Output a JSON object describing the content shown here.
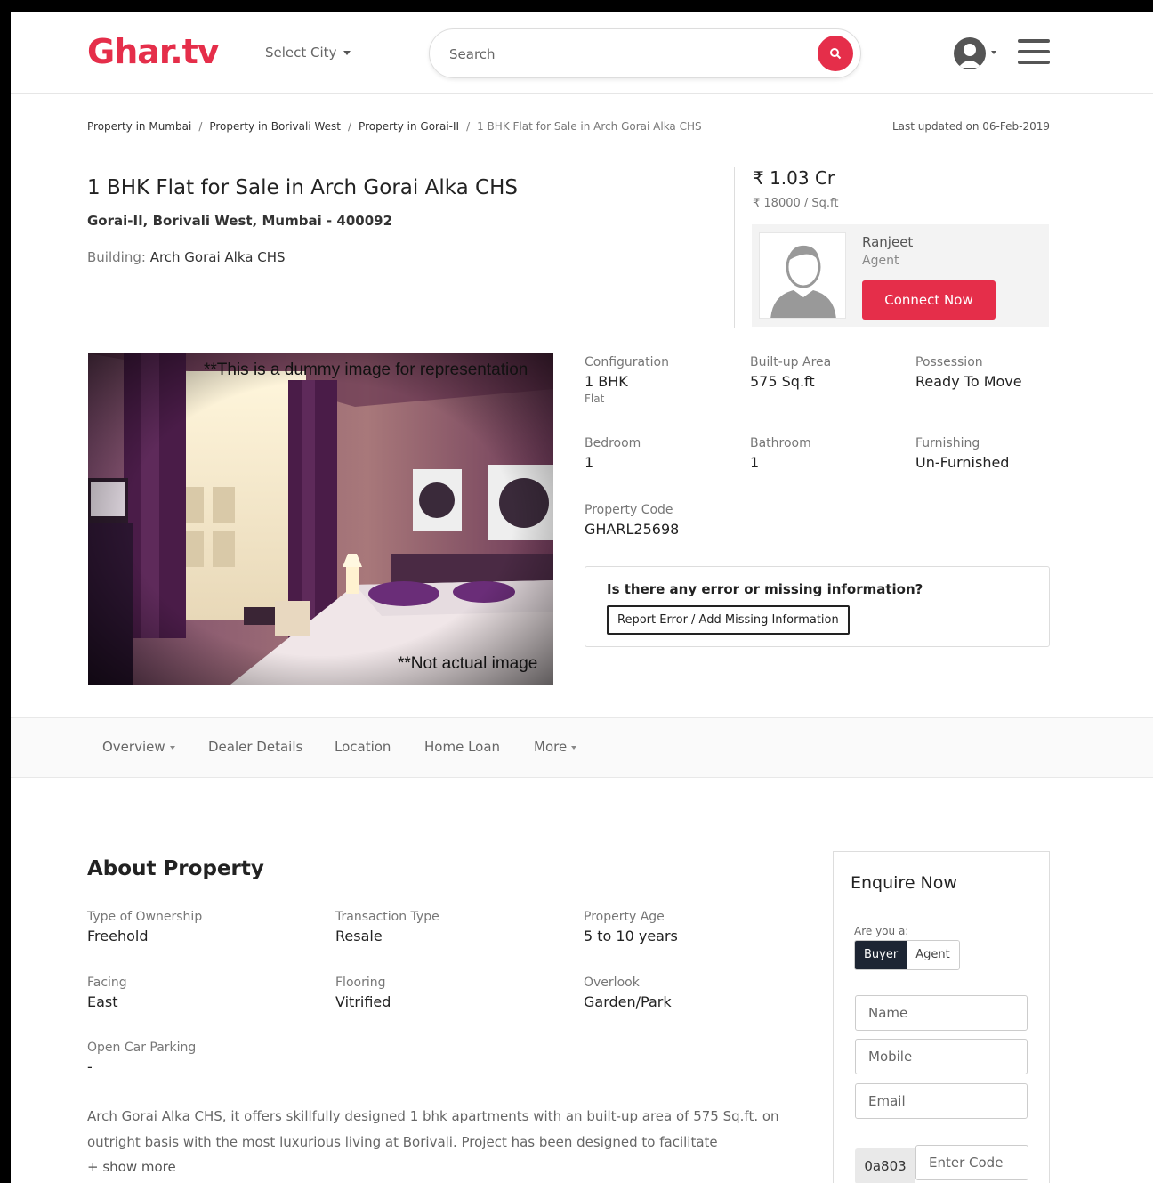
{
  "header": {
    "logo": "Ghar.tv",
    "select_city": "Select City",
    "search_placeholder": "Search",
    "brand_color": "#e52e4a"
  },
  "breadcrumb": {
    "items": [
      "Property in Mumbai",
      "Property in Borivali West",
      "Property in Gorai-II",
      "1 BHK Flat for Sale in Arch Gorai Alka CHS"
    ],
    "separator": "/",
    "last_updated": "Last updated on 06-Feb-2019"
  },
  "property": {
    "title": "1 BHK Flat for Sale in Arch Gorai Alka CHS",
    "address": "Gorai-II, Borivali West, Mumbai - 400092",
    "building_label": "Building:",
    "building_name": "Arch Gorai Alka CHS",
    "price": "₹ 1.03 Cr",
    "price_per_sqft": "₹ 18000 / Sq.ft",
    "image_caption_top": "**This is a dummy image for representation",
    "image_caption_bottom": "**Not actual image"
  },
  "agent": {
    "name": "Ranjeet",
    "role": "Agent",
    "connect_label": "Connect Now"
  },
  "specs": {
    "configuration": {
      "label": "Configuration",
      "value": "1 BHK",
      "sub": "Flat"
    },
    "builtup": {
      "label": "Built-up Area",
      "value": "575 Sq.ft"
    },
    "possession": {
      "label": "Possession",
      "value": "Ready To Move"
    },
    "bedroom": {
      "label": "Bedroom",
      "value": "1"
    },
    "bathroom": {
      "label": "Bathroom",
      "value": "1"
    },
    "furnishing": {
      "label": "Furnishing",
      "value": "Un-Furnished"
    },
    "code": {
      "label": "Property Code",
      "value": "GHARL25698"
    }
  },
  "error_box": {
    "question": "Is there any error or missing information?",
    "button": "Report Error / Add Missing Information"
  },
  "tabs": [
    "Overview",
    "Dealer Details",
    "Location",
    "Home Loan",
    "More"
  ],
  "about": {
    "title": "About Property",
    "fields": {
      "ownership": {
        "label": "Type of Ownership",
        "value": "Freehold"
      },
      "transaction": {
        "label": "Transaction Type",
        "value": "Resale"
      },
      "age": {
        "label": "Property Age",
        "value": "5 to 10 years"
      },
      "facing": {
        "label": "Facing",
        "value": "East"
      },
      "flooring": {
        "label": "Flooring",
        "value": "Vitrified"
      },
      "overlook": {
        "label": "Overlook",
        "value": "Garden/Park"
      },
      "parking": {
        "label": "Open Car Parking",
        "value": "-"
      }
    },
    "description": "Arch Gorai Alka CHS, it offers skillfully designed 1 bhk apartments with an built-up area of 575 Sq.ft. on outright basis with the most luxurious living at Borivali. Project has been designed to facilitate",
    "show_more": "+ show more"
  },
  "enquire": {
    "title": "Enquire Now",
    "are_you": "Are you a:",
    "buyer": "Buyer",
    "agent": "Agent",
    "name_placeholder": "Name",
    "mobile_placeholder": "Mobile",
    "email_placeholder": "Email",
    "captcha": "0a803",
    "code_placeholder": "Enter Code"
  }
}
